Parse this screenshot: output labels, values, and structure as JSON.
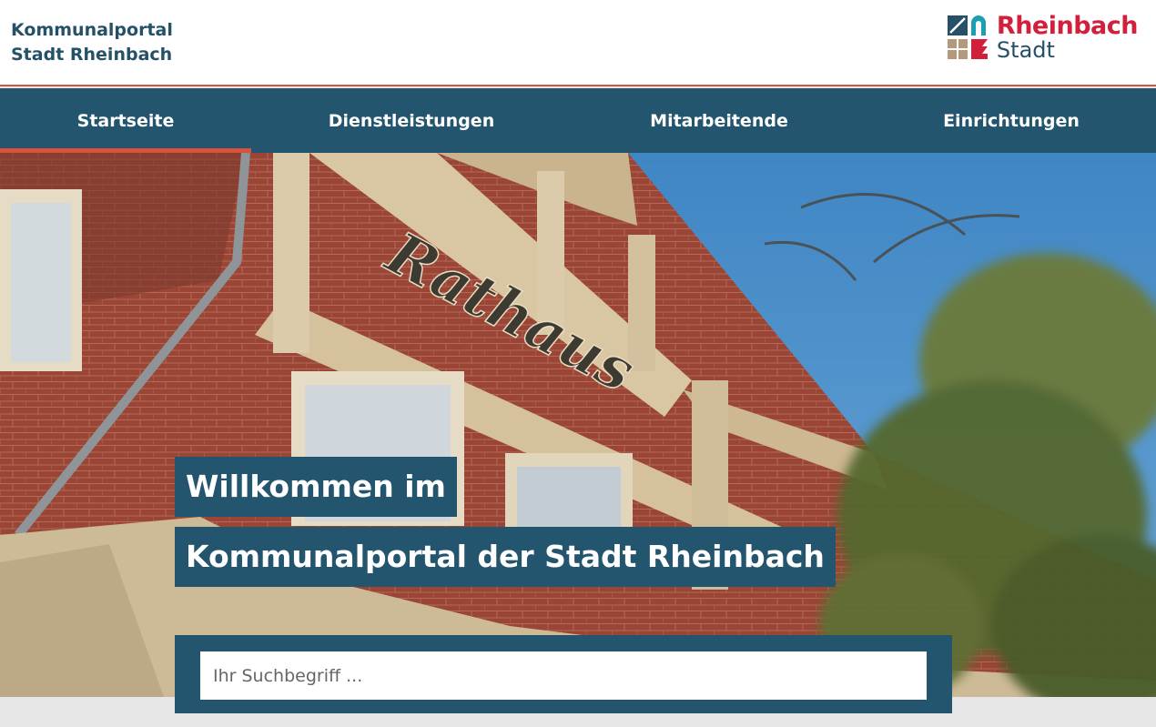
{
  "header": {
    "portal_title_line1": "Kommunalportal",
    "portal_title_line2": "Stadt Rheinbach",
    "logo_line1": "Rheinbach",
    "logo_line2": "Stadt"
  },
  "nav": {
    "items": [
      {
        "label": "Startseite",
        "active": true
      },
      {
        "label": "Dienstleistungen",
        "active": false
      },
      {
        "label": "Mitarbeitende",
        "active": false
      },
      {
        "label": "Einrichtungen",
        "active": false
      }
    ]
  },
  "hero": {
    "welcome_line1": "Willkommen im",
    "welcome_line2": "Kommunalportal der Stadt Rheinbach",
    "image_text": "Rathaus"
  },
  "search": {
    "placeholder": "Ihr Suchbegriff ..."
  },
  "colors": {
    "brand_blue": "#23566e",
    "accent_red": "#d9533b",
    "logo_red": "#d21f3c"
  }
}
